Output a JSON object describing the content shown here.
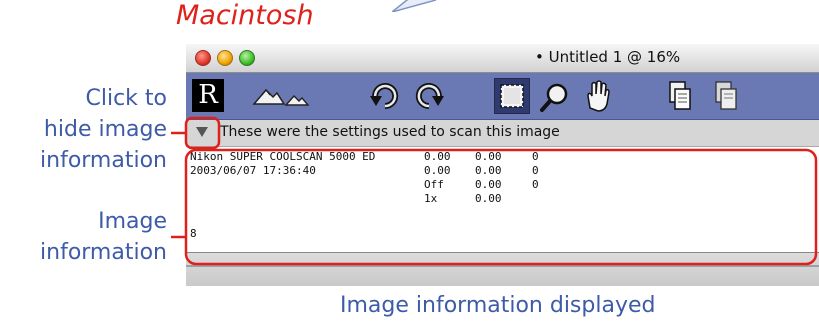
{
  "platform_label": "Macintosh",
  "callouts": {
    "hide_line1": "Click to",
    "hide_line2": "hide image",
    "hide_line3": "information",
    "info_line1": "Image",
    "info_line2": "information"
  },
  "caption": "Image information displayed",
  "window": {
    "title": "• Untitled 1 @ 16%",
    "toolbar": {
      "logo_letter": "R",
      "icons": [
        "mountain-large-icon",
        "mountain-small-icon",
        "rotate-left-icon",
        "rotate-right-icon",
        "crop-select-icon",
        "zoom-icon",
        "hand-icon",
        "copy-icon",
        "paste-icon"
      ]
    },
    "info_header": "These were the settings used to scan this image",
    "info_rows": [
      [
        "Nikon SUPER COOLSCAN 5000 ED",
        "0.00",
        "0.00",
        "0"
      ],
      [
        "2003/06/07 17:36:40",
        "0.00",
        "0.00",
        "0"
      ],
      [
        "",
        "Off",
        "0.00",
        "0"
      ],
      [
        "",
        "1x",
        "0.00",
        ""
      ],
      [
        "8",
        "",
        "",
        ""
      ]
    ]
  },
  "colors": {
    "highlight_red": "#e0201b",
    "callout_blue": "#3e5ba8",
    "toolbar_blue": "#6a78b4"
  }
}
